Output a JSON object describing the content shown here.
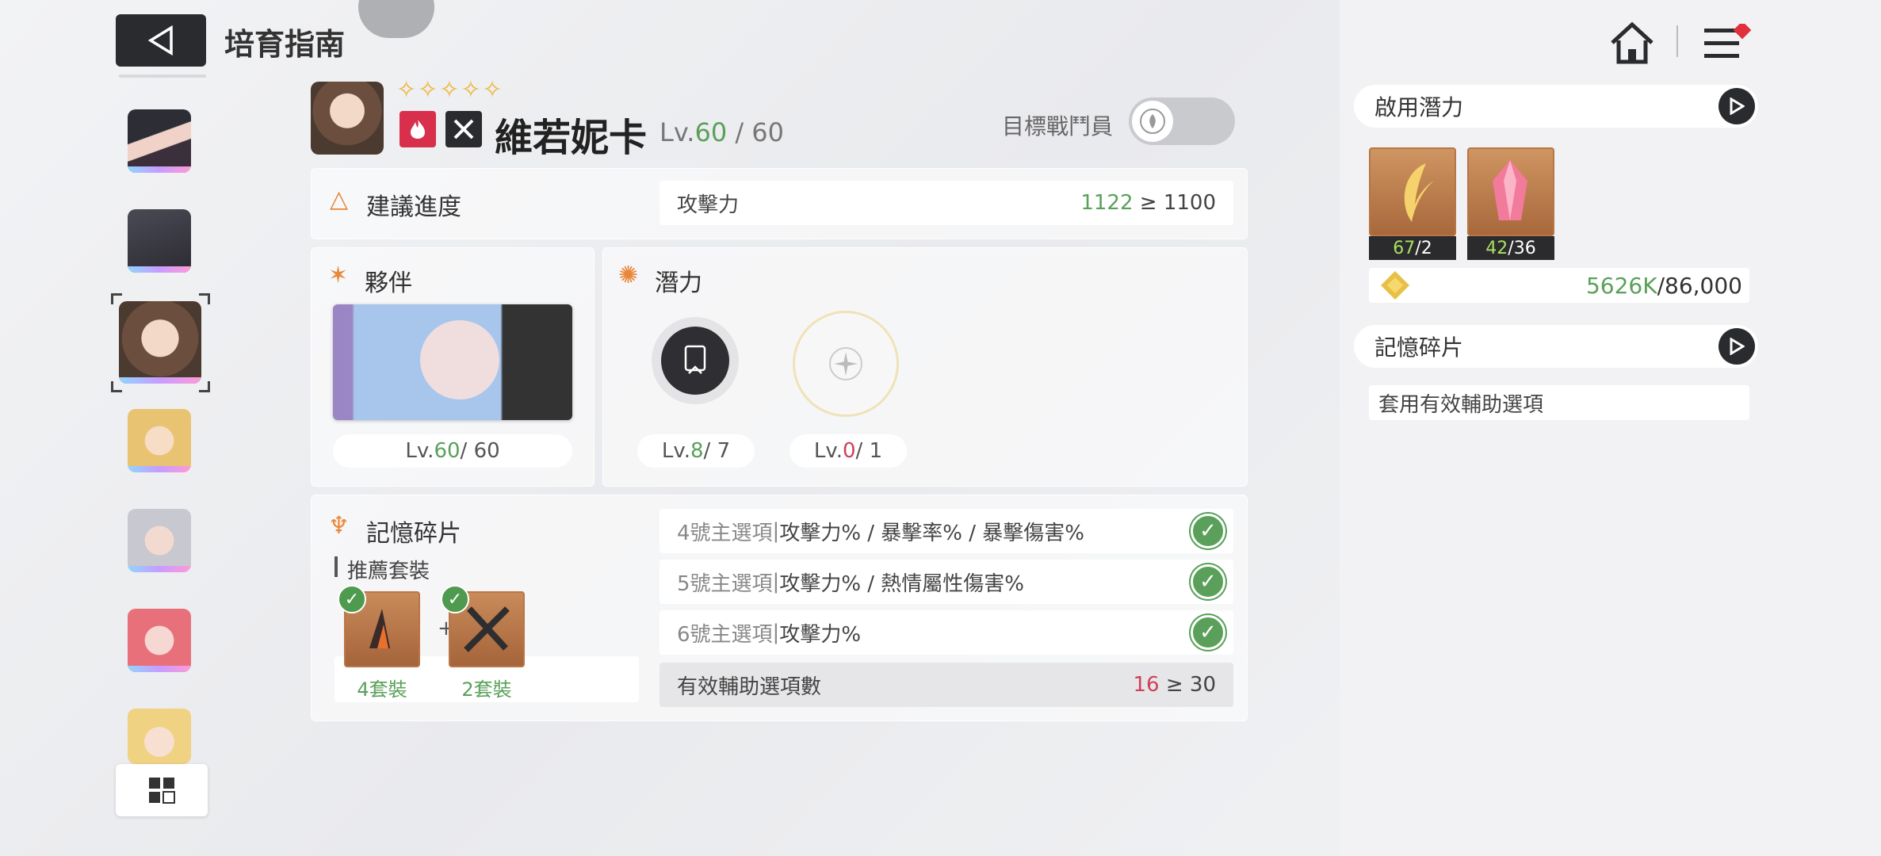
{
  "header": {
    "title": "培育指南"
  },
  "character": {
    "stars": "✧✧✧✧✧",
    "name": "維若妮卡",
    "lv_prefix": "Lv.",
    "lv_current": "60",
    "lv_max": "/ 60",
    "target_label": "目標戰鬥員"
  },
  "recommend": {
    "title": "建議進度",
    "stat_label": "攻擊力",
    "stat_current": "1122",
    "stat_sep": " ≥ ",
    "stat_target": "1100"
  },
  "partner": {
    "title": "夥伴",
    "lv_prefix": "Lv. ",
    "lv_current": "60",
    "lv_max": " / 60"
  },
  "potential": {
    "title": "潛力",
    "items": [
      {
        "lv_prefix": "Lv. ",
        "current": "8",
        "max": " / 7"
      },
      {
        "lv_prefix": "Lv. ",
        "current": "0",
        "max": " / 1"
      }
    ]
  },
  "memory": {
    "title": "記憶碎片",
    "recommend_set": "推薦套裝",
    "plus": "+",
    "set_a": "4套裝",
    "set_b": "2套裝",
    "options": [
      {
        "num": "4號主選項",
        "sep": " | ",
        "value": "攻擊力% / 暴擊率% / 暴擊傷害%"
      },
      {
        "num": "5號主選項",
        "sep": " | ",
        "value": "攻擊力% / 熱情屬性傷害%"
      },
      {
        "num": "6號主選項",
        "sep": " | ",
        "value": "攻擊力%"
      }
    ],
    "sub_label": "有效輔助選項數",
    "sub_current": "16",
    "sub_sep": " ≥ ",
    "sub_target": "30"
  },
  "right": {
    "potential_title": "啟用潛力",
    "mat1_have": "67",
    "mat1_need": "/2",
    "mat2_have": "42",
    "mat2_need": "/36",
    "gold_have": "5626K",
    "gold_need": "/86,000",
    "memory_title": "記憶碎片",
    "memory_sub": "套用有效輔助選項"
  },
  "colors": {
    "accent_green": "#5aa05a",
    "accent_red": "#d0405a",
    "accent_orange": "#e8873a",
    "dark_button": "#2a2b2e"
  }
}
